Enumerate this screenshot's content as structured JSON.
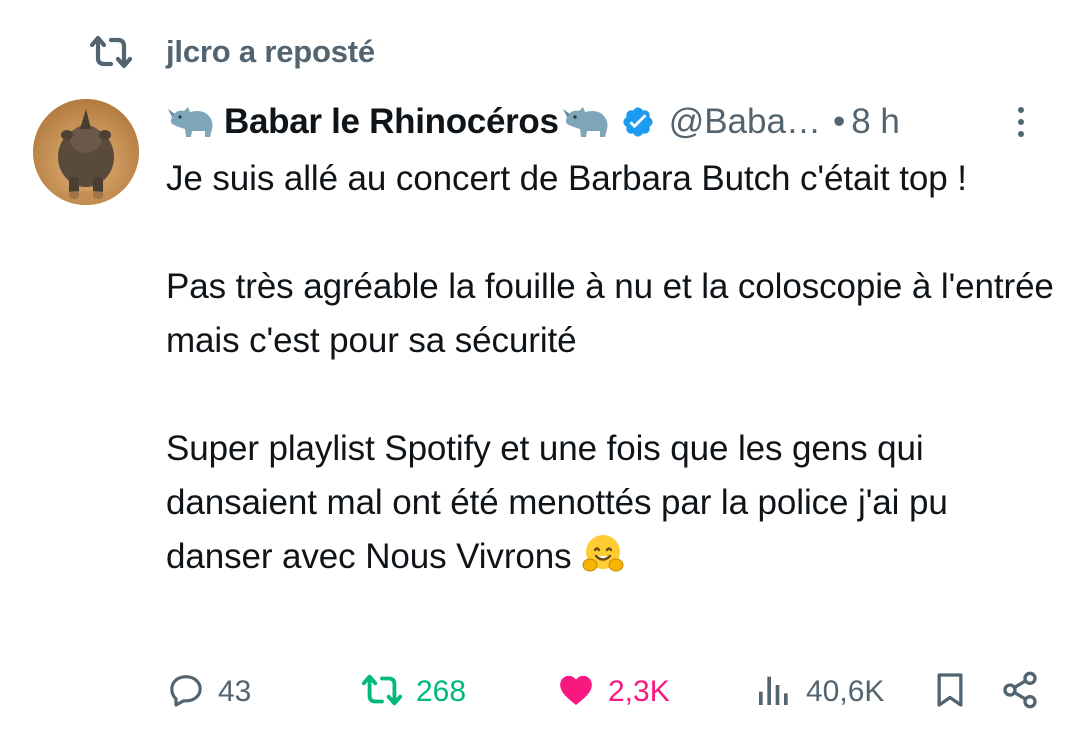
{
  "repost": {
    "icon": "repost-icon",
    "text": "jlcro a reposté"
  },
  "author": {
    "avatar": "rhino-avatar",
    "name_prefix_emoji": "rhino-emoji",
    "display_name": "Babar le Rhinocéros",
    "name_suffix_emoji": "rhino-emoji",
    "verified_icon": "verified-badge-icon",
    "handle": "@Baba…",
    "separator": "•",
    "time": "8 h",
    "more_icon": "more-vertical-icon"
  },
  "body": {
    "p1": "Je suis allé au concert de Barbara Butch c'était top !",
    "p2": "Pas très agréable la fouille à nu et la coloscopie à l'entrée mais c'est pour sa sécurité",
    "p3": "Super playlist Spotify et une fois que les gens qui dansaient mal ont été menottés par la police j'ai pu danser avec Nous Vivrons",
    "p3_emoji": "hugging-face-emoji"
  },
  "actions": {
    "reply": {
      "icon": "reply-icon",
      "count": "43"
    },
    "repost": {
      "icon": "repost-icon",
      "count": "268",
      "active_color": "#00ba7c"
    },
    "like": {
      "icon": "heart-icon",
      "count": "2,3K",
      "active_color": "#f91880"
    },
    "views": {
      "icon": "views-icon",
      "count": "40,6K"
    },
    "bookmark": {
      "icon": "bookmark-icon"
    },
    "share": {
      "icon": "share-icon"
    }
  },
  "colors": {
    "text": "#0f1419",
    "muted": "#536471",
    "verified": "#1d9bf0"
  }
}
